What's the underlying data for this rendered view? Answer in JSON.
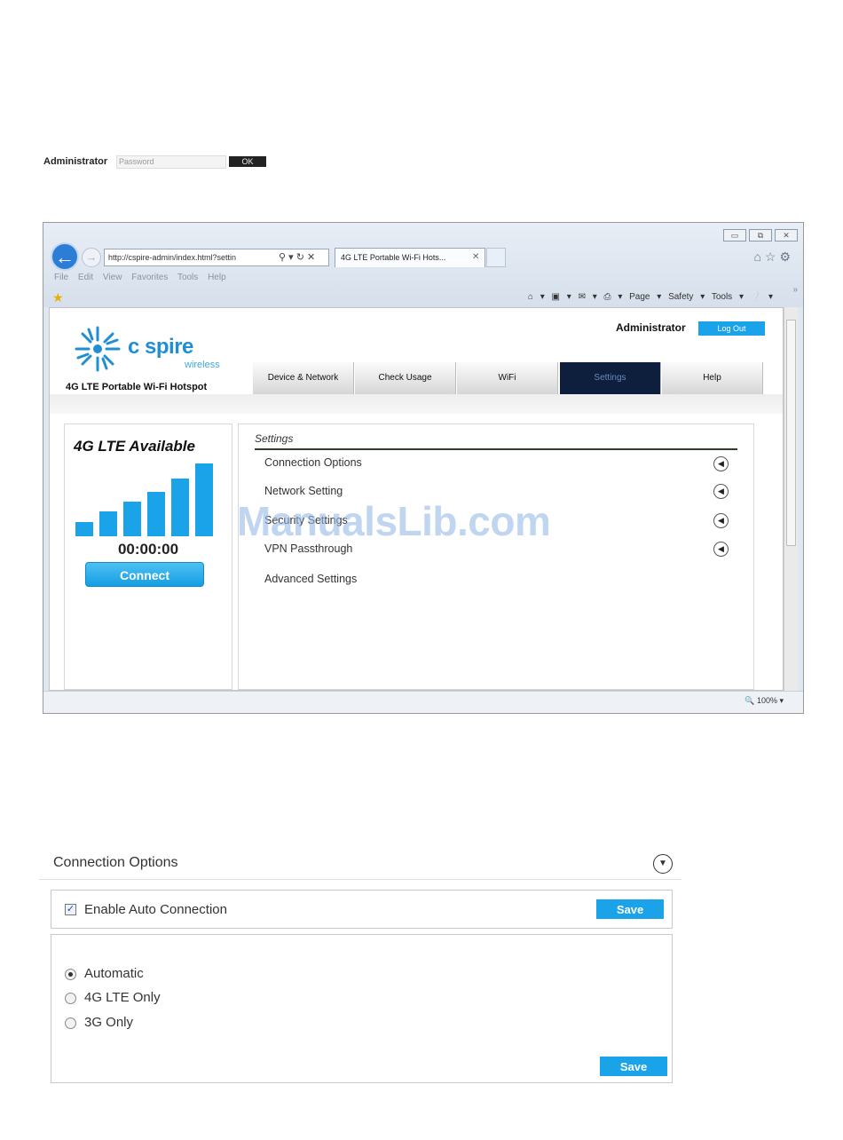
{
  "login": {
    "label": "Administrator",
    "password_placeholder": "Password",
    "ok_label": "OK"
  },
  "browser": {
    "window_buttons": [
      "▭",
      "⧉",
      "✕"
    ],
    "address": "http://cspire-admin/index.html?settin",
    "address_host": "cspire-admin",
    "tab_title": "4G LTE Portable Wi-Fi Hots...",
    "menu": [
      "File",
      "Edit",
      "View",
      "Favorites",
      "Tools",
      "Help"
    ],
    "command_bar": "Page ▾  Safety ▾  Tools ▾",
    "zoom": "100%"
  },
  "app": {
    "logo_main": "c spire",
    "logo_sub": "wireless",
    "product_name": "4G LTE Portable Wi-Fi Hotspot",
    "admin_label": "Administrator",
    "logout_label": "Log Out",
    "tabs": [
      {
        "label": "Device & Network",
        "active": false
      },
      {
        "label": "Check Usage",
        "active": false
      },
      {
        "label": "WiFi",
        "active": false
      },
      {
        "label": "Settings",
        "active": true
      },
      {
        "label": "Help",
        "active": false
      }
    ],
    "status": {
      "title": "4G LTE Available",
      "signal_bars": 6,
      "signal_level": 6,
      "timer": "00:00:00",
      "connect_label": "Connect"
    },
    "settings": {
      "title": "Settings",
      "items": [
        {
          "label": "Connection Options",
          "has_icon": true
        },
        {
          "label": "Network Setting",
          "has_icon": true
        },
        {
          "label": "Security Settings",
          "has_icon": true
        },
        {
          "label": "VPN Passthrough",
          "has_icon": true
        },
        {
          "label": "Advanced Settings",
          "has_icon": false
        }
      ]
    }
  },
  "watermark": "ManualsLib.com",
  "connection_options": {
    "title": "Connection Options",
    "auto_connection_label": "Enable Auto Connection",
    "auto_connection_checked": true,
    "save_label": "Save",
    "modes": [
      {
        "label": "Automatic",
        "selected": true
      },
      {
        "label": "4G LTE Only",
        "selected": false
      },
      {
        "label": "3G Only",
        "selected": false
      }
    ]
  }
}
